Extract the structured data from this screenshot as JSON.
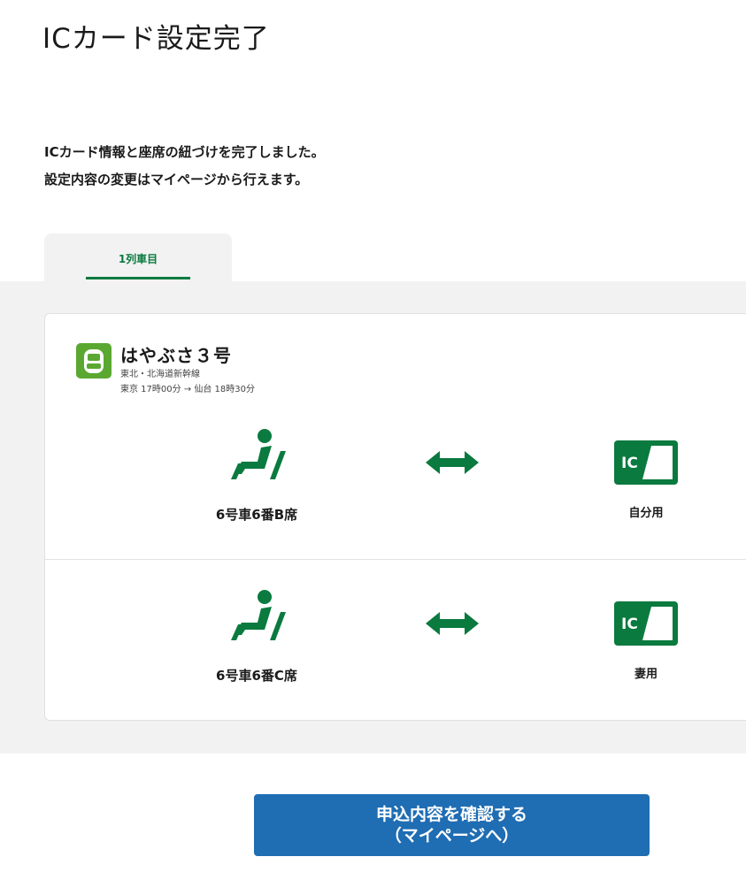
{
  "page": {
    "title": "ICカード設定完了",
    "message_line1": "ICカード情報と座席の紐づけを完了しました。",
    "message_line2": "設定内容の変更はマイページから行えます。"
  },
  "tabs": [
    {
      "label": "1列車目",
      "active": true
    }
  ],
  "train": {
    "icon": "train-icon",
    "name": "はやぶさ３号",
    "line": "東北・北海道新幹線",
    "schedule": "東京 17時00分 → 仙台 18時30分"
  },
  "assignments": [
    {
      "seat": "6号車6番B席",
      "ic_owner": "自分用",
      "ic_text": "IC"
    },
    {
      "seat": "6号車6番C席",
      "ic_owner": "妻用",
      "ic_text": "IC"
    }
  ],
  "confirm_button": {
    "line1": "申込内容を確認する",
    "line2": "（マイページへ）"
  },
  "colors": {
    "accent_green": "#0a7a3f",
    "train_green": "#5aa832",
    "button_blue": "#1f6db3",
    "panel_bg": "#f2f2f2"
  }
}
